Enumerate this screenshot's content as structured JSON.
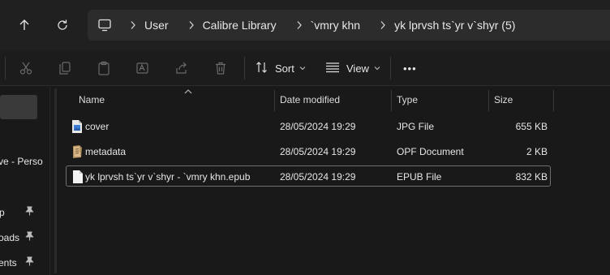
{
  "nav": {
    "breadcrumbs": [
      {
        "label": "User"
      },
      {
        "label": "Calibre Library"
      },
      {
        "label": "`vmry khn"
      },
      {
        "label": "yk lprvsh ts`yr v`shyr (5)"
      }
    ]
  },
  "toolbar": {
    "sort_label": "Sort",
    "view_label": "View",
    "more_label": "•••"
  },
  "sidebar": {
    "items": [
      {
        "label": "ve - Perso"
      },
      {
        "label": "p"
      },
      {
        "label": "oads"
      },
      {
        "label": "ents"
      }
    ]
  },
  "table": {
    "headers": {
      "name": "Name",
      "date": "Date modified",
      "type": "Type",
      "size": "Size"
    },
    "rows": [
      {
        "name": "cover",
        "date": "28/05/2024 19:29",
        "type": "JPG File",
        "size": "655 KB",
        "icon": "image-file-icon"
      },
      {
        "name": "metadata",
        "date": "28/05/2024 19:29",
        "type": "OPF Document",
        "size": "2 KB",
        "icon": "opf-file-icon"
      },
      {
        "name": "yk lprvsh ts`yr v`shyr - `vmry khn.epub",
        "date": "28/05/2024 19:29",
        "type": "EPUB File",
        "size": "832 KB",
        "icon": "document-file-icon"
      }
    ]
  },
  "colors": {
    "background": "#191919",
    "address_bar": "#2c2c2c",
    "selection_border": "#6e6e6e",
    "accent_blue": "#4a90d9"
  }
}
